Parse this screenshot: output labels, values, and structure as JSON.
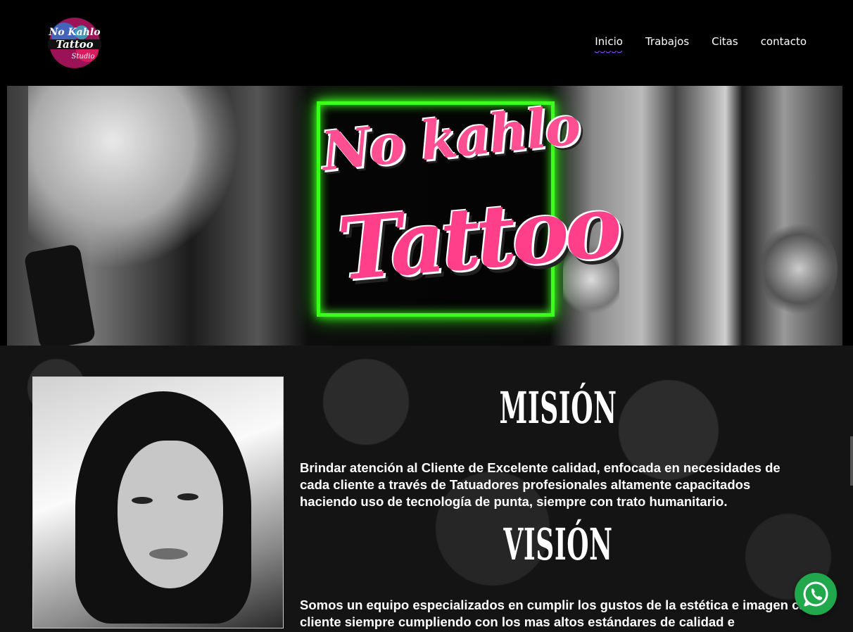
{
  "brand": {
    "logo_alt": "No Kahlo Tattoo Studio"
  },
  "nav": {
    "items": [
      {
        "label": "Inicio",
        "active": true
      },
      {
        "label": "Trabajos"
      },
      {
        "label": "Citas"
      },
      {
        "label": "contacto"
      }
    ]
  },
  "hero": {
    "title_line1": "No kahlo",
    "title_line2": "Tattoo"
  },
  "mision": {
    "title": "MISIÓN",
    "text": "Brindar atención al Cliente de Excelente calidad, enfocada en necesidades de cada cliente a través de Tatuadores profesionales altamente capacitados haciendo uso de tecnología de punta, siempre con trato humanitario."
  },
  "vision": {
    "title": "VISIÓN",
    "text": "Somos un equipo especializados en cumplir los gustos de la estética e imagen cada cliente siempre cumpliendo con los mas altos estándares de calidad e"
  },
  "whatsapp": {
    "icon": "whatsapp-icon"
  },
  "colors": {
    "neon": "#3cff1e",
    "pink": "#ff3f8a",
    "nav_underline": "#7b3ff0",
    "whatsapp": "#21a74c"
  }
}
